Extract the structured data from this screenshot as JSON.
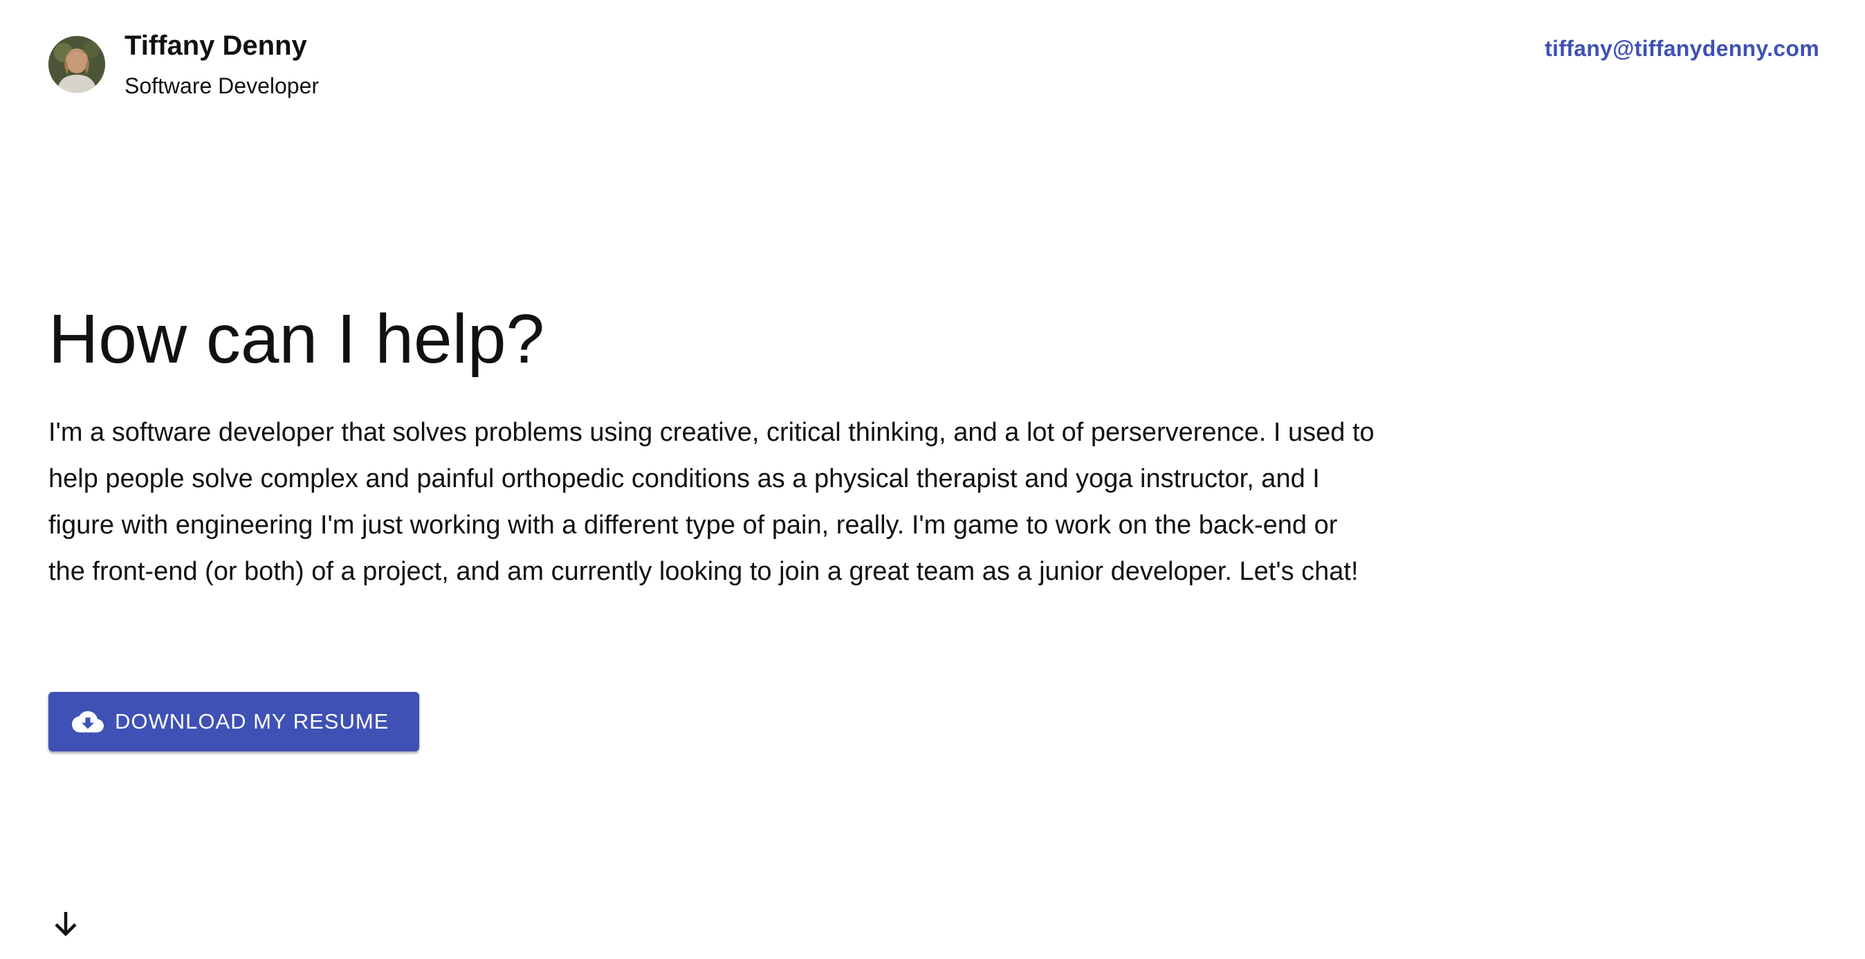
{
  "header": {
    "name": "Tiffany Denny",
    "role": "Software Developer",
    "email": "tiffany@tiffanydenny.com",
    "avatar_icon": "profile-photo"
  },
  "hero": {
    "title": "How can I help?",
    "text": "I'm a software developer that solves problems using creative, critical thinking, and a lot of perserverence. I used to help people solve complex and painful orthopedic conditions as a physical therapist and yoga instructor, and I figure with engineering I'm just working with a different type of pain, really. I'm game to work on the back-end or the front-end (or both) of a project, and am currently looking to join a great team as a junior developer. Let's chat!",
    "download_label": "Download My Resume",
    "download_icon": "cloud-download-icon"
  },
  "scroll": {
    "icon": "arrow-down-icon"
  },
  "colors": {
    "accent": "#3f51b5",
    "text": "#111111",
    "background": "#ffffff"
  }
}
